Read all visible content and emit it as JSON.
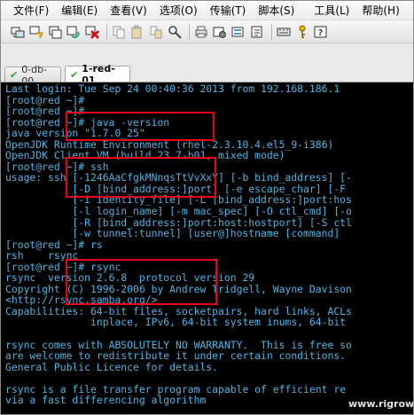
{
  "menu": [
    "文件(F)",
    "编辑(E)",
    "查看(V)",
    "选项(O)",
    "传输(T)",
    "脚本(S)",
    "工具(L)",
    "帮助(H)"
  ],
  "toolbar": {
    "icons": [
      "connect-icon",
      "quick-connect-icon",
      "connect-tab-icon",
      "reconnect-icon",
      "disconnect-icon",
      "copy-icon",
      "paste-icon",
      "copy-paste-icon",
      "find-icon",
      "print-icon",
      "settings-icon",
      "session-options-icon",
      "sftp-icon",
      "keymap-icon",
      "key-icon",
      "help-icon"
    ]
  },
  "tabs": [
    {
      "label": "0-db-00",
      "status": "connected",
      "active": false
    },
    {
      "label": "1-red-01",
      "status": "connected",
      "active": true
    }
  ],
  "terminal": {
    "text_color": "#4fb3e2",
    "background": "#000000",
    "lines": [
      "Last login: Tue Sep 24 00:40:36 2013 from 192.168.186.1",
      "[root@red ~]#",
      "[root@red ~]#",
      "[root@red ~]# java -version",
      "java version \"1.7.0_25\"",
      "OpenJDK Runtime Environment (rhel-2.3.10.4.el5_9-i386)",
      "OpenJDK Client VM (build 23.7-b01, mixed mode)",
      "[root@red ~]# ssh",
      "usage: ssh [-1246AaCfgkMNnqsTtVvXxY] [-b bind_address] [-",
      "           [-D [bind_address:]port] [-e escape_char] [-F",
      "           [-i identity_file] [-L [bind_address:]port:hos",
      "           [-l login_name] [-m mac_spec] [-O ctl_cmd] [-o",
      "           [-R [bind_address:]port:host:hostport] [-S ctl",
      "           [-w tunnel:tunnel] [user@]hostname [command]",
      "[root@red ~]# rs",
      "rsh    rsync",
      "[root@red ~]# rsync",
      "rsync  version 2.6.8  protocol version 29",
      "Copyright (C) 1996-2006 by Andrew Tridgell, Wayne Davison",
      "<http://rsync.samba.org/>",
      "Capabilities: 64-bit files, socketpairs, hard links, ACLs",
      "              inplace, IPv6, 64-bit system inums, 64-bit",
      "",
      "rsync comes with ABSOLUTELY NO WARRANTY.  This is free so",
      "are welcome to redistribute it under certain conditions.",
      "General Public Licence for details.",
      "",
      "rsync is a file transfer program capable of efficient re",
      "via a fast differencing algorithm"
    ]
  },
  "watermark": "www.rigrowing.com"
}
